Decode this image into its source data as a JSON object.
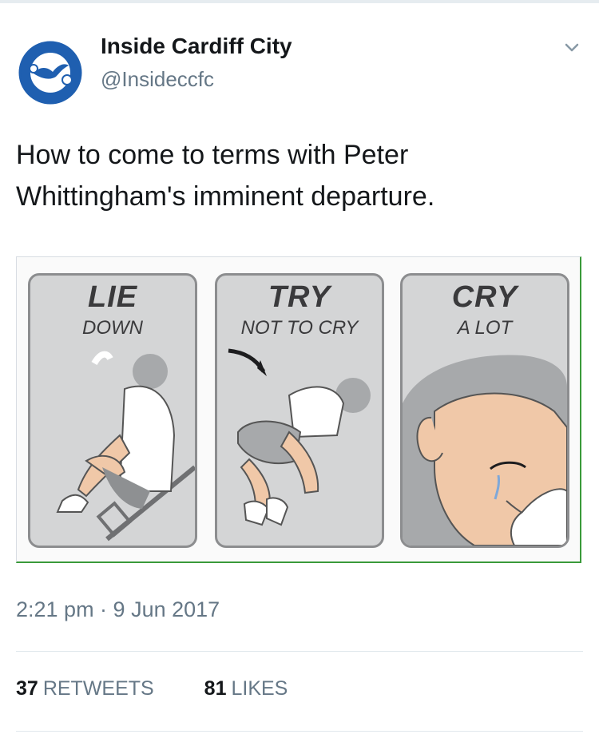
{
  "tweet": {
    "display_name": "Inside Cardiff City",
    "handle": "@Insideccfc",
    "text": "How to come to terms with Peter Whittingham's imminent departure.",
    "timestamp": "2:21 pm · 9 Jun 2017"
  },
  "media": {
    "panels": [
      {
        "title": "LIE",
        "subtitle": "DOWN"
      },
      {
        "title": "TRY",
        "subtitle": "NOT TO CRY"
      },
      {
        "title": "CRY",
        "subtitle": "A LOT"
      }
    ]
  },
  "stats": {
    "retweets_count": "37",
    "retweets_label": "RETWEETS",
    "likes_count": "81",
    "likes_label": "LIKES"
  },
  "colors": {
    "text_primary": "#14171a",
    "text_secondary": "#657786",
    "divider": "#e1e8ed",
    "badge_blue": "#1f5fb0"
  },
  "icons": [
    "cardiff-city-badge-avatar",
    "chevron-down-icon"
  ]
}
